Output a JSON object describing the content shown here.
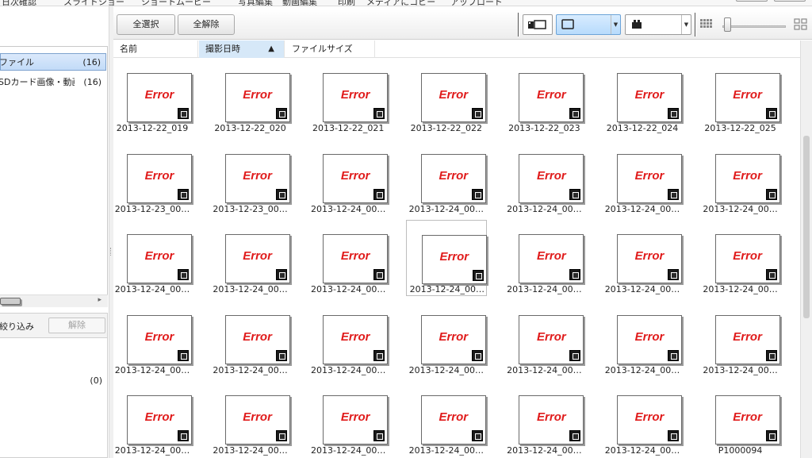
{
  "menubar": {
    "items": [
      "日次確認",
      "スライドショー",
      "ショートムービー",
      "写真編集",
      "動画編集",
      "印刷",
      "メディアにコピー",
      "アップロード"
    ]
  },
  "sidebar": {
    "tree": [
      {
        "label": "ファイル",
        "count": "(16)",
        "selected": true
      },
      {
        "label": "SDカード画像・動画",
        "count": "(16)",
        "selected": false
      }
    ],
    "filter": {
      "label": "絞り込み",
      "clear_label": "解除",
      "count": "(0)"
    }
  },
  "toolbar": {
    "select_all_label": "全選択",
    "deselect_all_label": "全解除",
    "view_icons": [
      "film-strip-icon",
      "single-frame-icon",
      "camera-icon"
    ],
    "slider_value": 0.05
  },
  "columns": [
    {
      "label": "名前",
      "sorted": false
    },
    {
      "label": "撮影日時",
      "sorted": true,
      "sort": "ascending"
    },
    {
      "label": "ファイルサイズ",
      "sorted": false
    }
  ],
  "thumbnails": {
    "error_text": "Error",
    "items": [
      "2013-12-22_019",
      "2013-12-22_020",
      "2013-12-22_021",
      "2013-12-22_022",
      "2013-12-22_023",
      "2013-12-22_024",
      "2013-12-22_025",
      "2013-12-23_00…",
      "2013-12-23_00…",
      "2013-12-24_00…",
      "2013-12-24_00…",
      "2013-12-24_00…",
      "2013-12-24_00…",
      "2013-12-24_00…",
      "2013-12-24_00…",
      "2013-12-24_00…",
      "2013-12-24_00…",
      "2013-12-24_00…",
      "2013-12-24_00…",
      "2013-12-24_00…",
      "2013-12-24_00…",
      "2013-12-24_00…",
      "2013-12-24_00…",
      "2013-12-24_00…",
      "2013-12-24_00…",
      "2013-12-24_00…",
      "2013-12-24_00…",
      "2013-12-24_00…",
      "2013-12-24_00…",
      "2013-12-24_00…",
      "2013-12-24_00…",
      "2013-12-24_00…",
      "2013-12-24_00…",
      "2013-12-24_00…",
      "P1000094"
    ],
    "focused_index": 17
  },
  "colors": {
    "error_red": "#e01b1b",
    "selection_blue": "#c2dbf8",
    "active_view": "#b7dbfc"
  }
}
